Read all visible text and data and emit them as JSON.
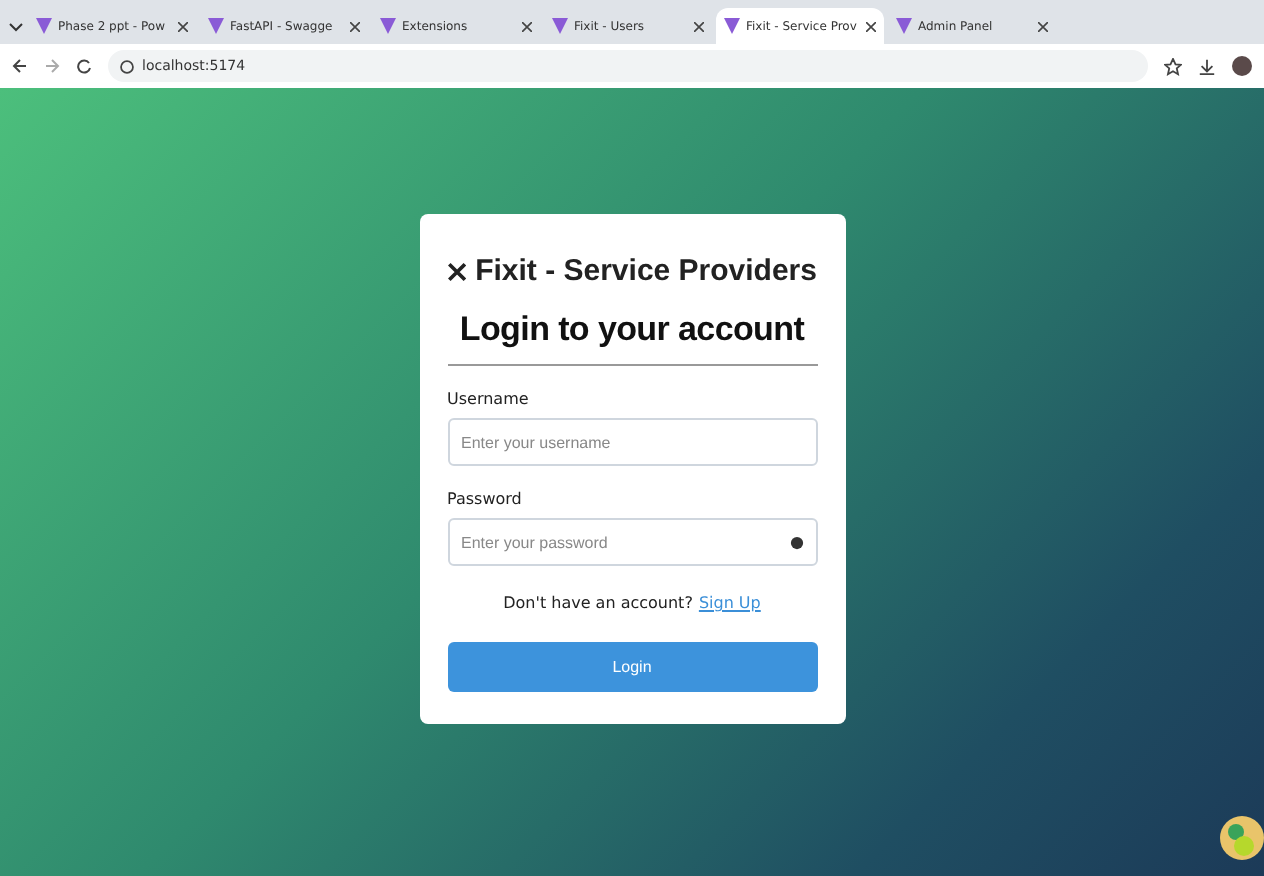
{
  "tabs": [
    {
      "title": "Phase 2 ppt - Pow",
      "selected": false
    },
    {
      "title": "FastAPI - Swagge",
      "selected": false
    },
    {
      "title": "Extensions",
      "selected": false
    },
    {
      "title": "Fixit - Users",
      "selected": false
    },
    {
      "title": "Fixit - Service Prov",
      "selected": true
    },
    {
      "title": "Admin Panel",
      "selected": false
    }
  ],
  "address_bar": {
    "url": "localhost:5174"
  },
  "login_card": {
    "brand": "Fixit - Service Providers",
    "heading": "Login to your account",
    "fields": [
      {
        "label": "Username",
        "placeholder": "Enter your username",
        "kind": "text"
      },
      {
        "label": "Password",
        "placeholder": "Enter your password",
        "kind": "password"
      }
    ],
    "signup_prompt": "Don't have an account?",
    "signup_link": "Sign Up",
    "login_button": "Login"
  }
}
